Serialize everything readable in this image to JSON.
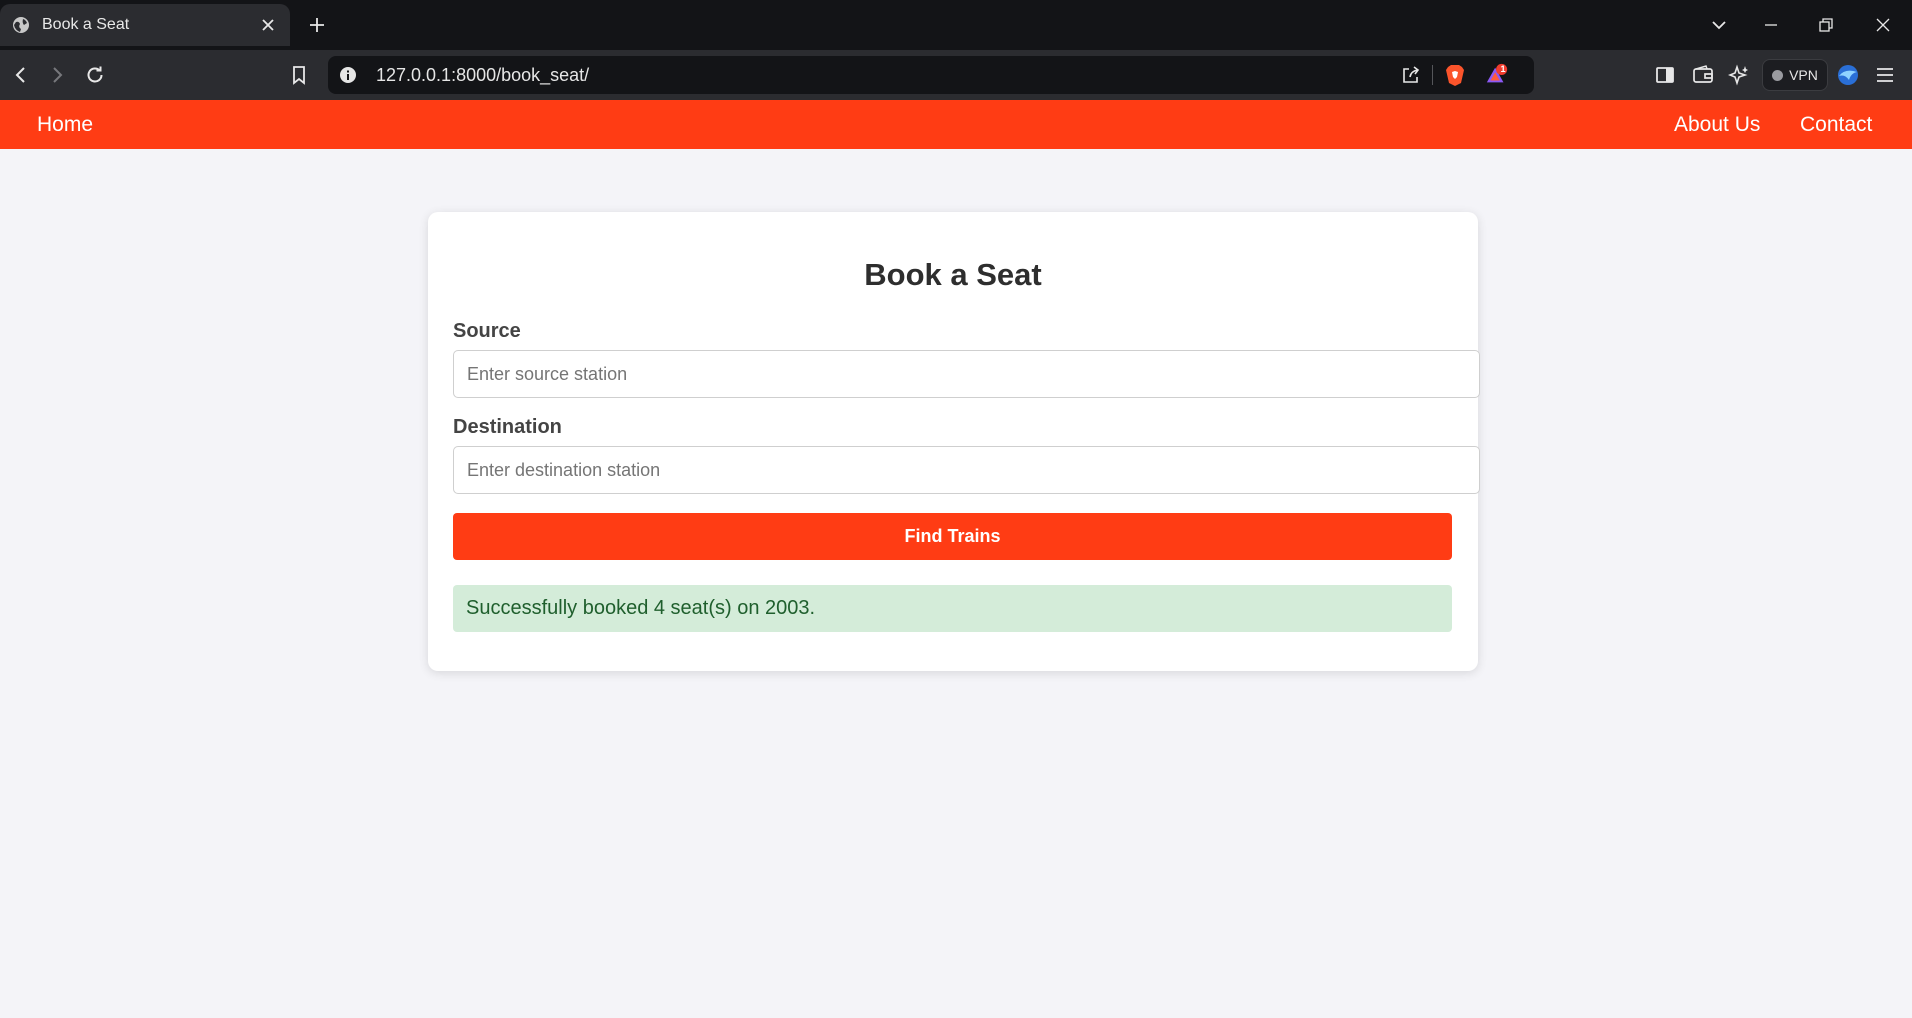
{
  "browser": {
    "tab_title": "Book a Seat",
    "url": "127.0.0.1:8000/book_seat/",
    "vpn_label": "VPN",
    "notification_count": "1",
    "icons": [
      "globe-icon",
      "close-icon",
      "plus-icon",
      "chevron-down-icon",
      "minimize-icon",
      "restore-icon",
      "back-icon",
      "forward-icon",
      "reload-icon",
      "bookmark-icon",
      "info-icon",
      "share-icon",
      "brave-shield-icon",
      "brave-rewards-icon",
      "sidebar-icon",
      "wallet-icon",
      "leo-ai-icon",
      "profile-icon",
      "menu-icon"
    ]
  },
  "navbar": {
    "home": "Home",
    "about": "About Us",
    "contact": "Contact",
    "color": "#ff3c14"
  },
  "form": {
    "title": "Book a Seat",
    "source_label": "Source",
    "source_placeholder": "Enter source station",
    "destination_label": "Destination",
    "destination_placeholder": "Enter destination station",
    "submit_label": "Find Trains",
    "success_message": "Successfully booked 4 seat(s) on 2003."
  }
}
